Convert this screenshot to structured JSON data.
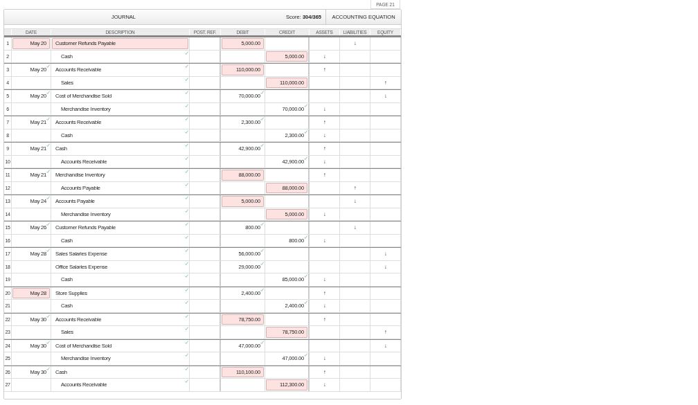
{
  "page": {
    "label": "PAGE 21"
  },
  "header": {
    "title": "JOURNAL",
    "score": "Score: **304/365**",
    "equation_title": "ACCOUNTING EQUATION"
  },
  "columns": [
    "DATE",
    "DESCRIPTION",
    "POST. REF.",
    "DEBIT",
    "CREDIT",
    "ASSETS",
    "LIABILITIES",
    "EQUITY"
  ],
  "entries": [
    {
      "rows": [
        {
          "line": "1",
          "date": {
            "text": "May 20",
            "error": true,
            "checked": false
          },
          "description": {
            "text": "Customer Refunds Payable",
            "error": true,
            "checked": false,
            "indent": false
          },
          "debit": {
            "text": "5,000.00",
            "error": true,
            "checked": false
          },
          "liabilities": "↓"
        },
        {
          "line": "2",
          "description": {
            "text": "Cash",
            "error": false,
            "checked": true,
            "indent": true
          },
          "credit": {
            "text": "5,000.00",
            "error": true,
            "checked": false
          },
          "assets": "↓"
        }
      ]
    },
    {
      "rows": [
        {
          "line": "3",
          "date": {
            "text": "May 20",
            "error": false,
            "checked": true
          },
          "description": {
            "text": "Accounts Receivable",
            "error": false,
            "checked": true,
            "indent": false
          },
          "debit": {
            "text": "110,000.00",
            "error": true,
            "checked": false
          },
          "assets": "↑"
        },
        {
          "line": "4",
          "description": {
            "text": "Sales",
            "error": false,
            "checked": true,
            "indent": true
          },
          "credit": {
            "text": "110,000.00",
            "error": true,
            "checked": false
          },
          "equity": "↑"
        }
      ]
    },
    {
      "rows": [
        {
          "line": "5",
          "date": {
            "text": "May 20",
            "error": false,
            "checked": true
          },
          "description": {
            "text": "Cost of Merchandise Sold",
            "error": false,
            "checked": true,
            "indent": false
          },
          "debit": {
            "text": "70,000.00",
            "error": false,
            "checked": true
          },
          "equity": "↓"
        },
        {
          "line": "6",
          "description": {
            "text": "Merchandise Inventory",
            "error": false,
            "checked": true,
            "indent": true
          },
          "credit": {
            "text": "70,000.00",
            "error": false,
            "checked": true
          },
          "assets": "↓"
        }
      ]
    },
    {
      "rows": [
        {
          "line": "7",
          "date": {
            "text": "May 21",
            "error": false,
            "checked": true
          },
          "description": {
            "text": "Accounts Receivable",
            "error": false,
            "checked": true,
            "indent": false
          },
          "debit": {
            "text": "2,300.00",
            "error": false,
            "checked": true
          },
          "assets": "↑"
        },
        {
          "line": "8",
          "description": {
            "text": "Cash",
            "error": false,
            "checked": true,
            "indent": true
          },
          "credit": {
            "text": "2,300.00",
            "error": false,
            "checked": true
          },
          "assets": "↓"
        }
      ]
    },
    {
      "rows": [
        {
          "line": "9",
          "date": {
            "text": "May 21",
            "error": false,
            "checked": true
          },
          "description": {
            "text": "Cash",
            "error": false,
            "checked": true,
            "indent": false
          },
          "debit": {
            "text": "42,900.00",
            "error": false,
            "checked": true
          },
          "assets": "↑"
        },
        {
          "line": "10",
          "description": {
            "text": "Accounts Receivable",
            "error": false,
            "checked": true,
            "indent": true
          },
          "credit": {
            "text": "42,900.00",
            "error": false,
            "checked": true
          },
          "assets": "↓"
        }
      ]
    },
    {
      "rows": [
        {
          "line": "11",
          "date": {
            "text": "May 21",
            "error": false,
            "checked": true
          },
          "description": {
            "text": "Merchandise Inventory",
            "error": false,
            "checked": true,
            "indent": false
          },
          "debit": {
            "text": "88,000.00",
            "error": true,
            "checked": false
          },
          "assets": "↑"
        },
        {
          "line": "12",
          "description": {
            "text": "Accounts Payable",
            "error": false,
            "checked": true,
            "indent": true
          },
          "credit": {
            "text": "88,000.00",
            "error": true,
            "checked": false
          },
          "liabilities": "↑"
        }
      ]
    },
    {
      "rows": [
        {
          "line": "13",
          "date": {
            "text": "May 24",
            "error": false,
            "checked": true
          },
          "description": {
            "text": "Accounts Payable",
            "error": false,
            "checked": true,
            "indent": false
          },
          "debit": {
            "text": "5,000.00",
            "error": true,
            "checked": false
          },
          "liabilities": "↓"
        },
        {
          "line": "14",
          "description": {
            "text": "Merchandise Inventory",
            "error": false,
            "checked": true,
            "indent": true
          },
          "credit": {
            "text": "5,000.00",
            "error": true,
            "checked": false
          },
          "assets": "↓"
        }
      ]
    },
    {
      "rows": [
        {
          "line": "15",
          "date": {
            "text": "May 26",
            "error": false,
            "checked": true
          },
          "description": {
            "text": "Customer Refunds Payable",
            "error": false,
            "checked": true,
            "indent": false
          },
          "debit": {
            "text": "800.00",
            "error": false,
            "checked": true
          },
          "liabilities": "↓"
        },
        {
          "line": "16",
          "description": {
            "text": "Cash",
            "error": false,
            "checked": true,
            "indent": true
          },
          "credit": {
            "text": "800.00",
            "error": false,
            "checked": true
          },
          "assets": "↓"
        }
      ]
    },
    {
      "rows": [
        {
          "line": "17",
          "date": {
            "text": "May 28",
            "error": false,
            "checked": true
          },
          "description": {
            "text": "Sales Salaries Expense",
            "error": false,
            "checked": true,
            "indent": false
          },
          "debit": {
            "text": "56,000.00",
            "error": false,
            "checked": true
          },
          "equity": "↓"
        },
        {
          "line": "18",
          "description": {
            "text": "Office Salaries Expense",
            "error": false,
            "checked": true,
            "indent": false
          },
          "debit": {
            "text": "29,000.00",
            "error": false,
            "checked": true
          },
          "equity": "↓"
        },
        {
          "line": "19",
          "description": {
            "text": "Cash",
            "error": false,
            "checked": true,
            "indent": true
          },
          "credit": {
            "text": "85,000.00",
            "error": false,
            "checked": true
          },
          "assets": "↓"
        }
      ]
    },
    {
      "rows": [
        {
          "line": "20",
          "date": {
            "text": "May 28",
            "error": true,
            "checked": false
          },
          "description": {
            "text": "Store Supplies",
            "error": false,
            "checked": true,
            "indent": false
          },
          "debit": {
            "text": "2,400.00",
            "error": false,
            "checked": true
          },
          "assets": "↑"
        },
        {
          "line": "21",
          "description": {
            "text": "Cash",
            "error": false,
            "checked": true,
            "indent": true
          },
          "credit": {
            "text": "2,400.00",
            "error": false,
            "checked": true
          },
          "assets": "↓"
        }
      ]
    },
    {
      "rows": [
        {
          "line": "22",
          "date": {
            "text": "May 30",
            "error": false,
            "checked": true
          },
          "description": {
            "text": "Accounts Receivable",
            "error": false,
            "checked": true,
            "indent": false
          },
          "debit": {
            "text": "78,750.00",
            "error": true,
            "checked": false
          },
          "assets": "↑"
        },
        {
          "line": "23",
          "description": {
            "text": "Sales",
            "error": false,
            "checked": true,
            "indent": true
          },
          "credit": {
            "text": "78,750.00",
            "error": true,
            "checked": false
          },
          "equity": "↑"
        }
      ]
    },
    {
      "rows": [
        {
          "line": "24",
          "date": {
            "text": "May 30",
            "error": false,
            "checked": true
          },
          "description": {
            "text": "Cost of Merchandise Sold",
            "error": false,
            "checked": true,
            "indent": false
          },
          "debit": {
            "text": "47,000.00",
            "error": false,
            "checked": true
          },
          "equity": "↓"
        },
        {
          "line": "25",
          "description": {
            "text": "Merchandise Inventory",
            "error": false,
            "checked": true,
            "indent": true
          },
          "credit": {
            "text": "47,000.00",
            "error": false,
            "checked": true
          },
          "assets": "↓"
        }
      ]
    },
    {
      "rows": [
        {
          "line": "26",
          "date": {
            "text": "May 30",
            "error": false,
            "checked": true
          },
          "description": {
            "text": "Cash",
            "error": false,
            "checked": true,
            "indent": false
          },
          "debit": {
            "text": "110,100.00",
            "error": true,
            "checked": false
          },
          "assets": "↑"
        },
        {
          "line": "27",
          "description": {
            "text": "Accounts Receivable",
            "error": false,
            "checked": true,
            "indent": true
          },
          "credit": {
            "text": "112,300.00",
            "error": true,
            "checked": false
          },
          "assets": "↓"
        }
      ]
    }
  ]
}
